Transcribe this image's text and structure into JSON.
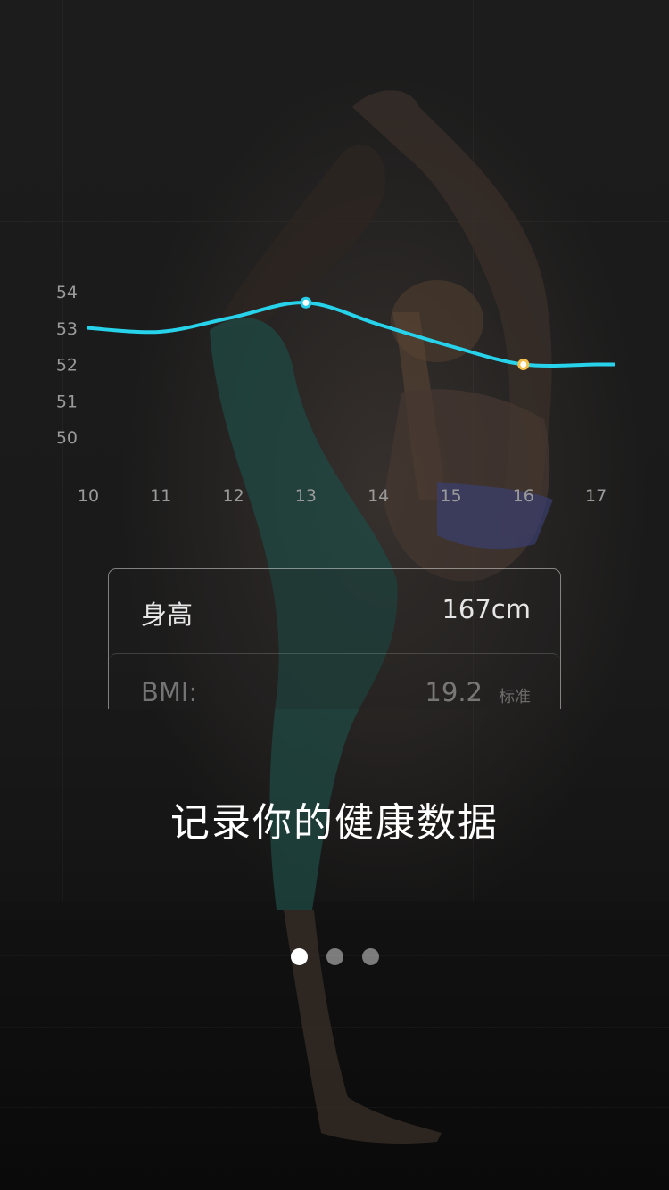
{
  "chart_data": {
    "type": "line",
    "x": [
      "10",
      "11",
      "12",
      "13",
      "14",
      "15",
      "16",
      "17"
    ],
    "series": [
      {
        "values": [
          53.0,
          52.9,
          53.3,
          53.7,
          53.1,
          52.5,
          52.0,
          52.0
        ]
      }
    ],
    "y_ticks": [
      "54",
      "53",
      "52",
      "51",
      "50"
    ],
    "ylim": [
      50,
      54
    ],
    "highlight": [
      {
        "x": "13",
        "color": "#27cbe6"
      },
      {
        "x": "16",
        "color": "#f2be49"
      }
    ],
    "line_color": "#27d2eb",
    "grid": false
  },
  "stats": {
    "height": {
      "label": "身高",
      "value": "167cm"
    },
    "bmi": {
      "label": "BMI:",
      "value": "19.2",
      "tag": "标准"
    }
  },
  "headline": "记录你的健康数据",
  "pager": {
    "count": 3,
    "active_index": 0
  }
}
